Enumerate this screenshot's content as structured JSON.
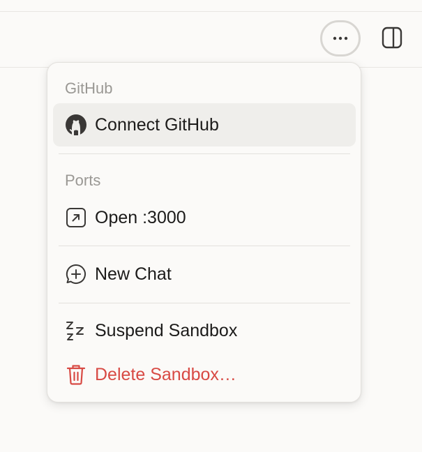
{
  "toolbar": {
    "more_icon": "ellipsis-icon",
    "panel_icon": "sidebar-toggle-icon"
  },
  "menu": {
    "github_section_label": "GitHub",
    "connect_github_label": "Connect GitHub",
    "ports_section_label": "Ports",
    "open_port_label": "Open :3000",
    "new_chat_label": "New Chat",
    "suspend_label": "Suspend Sandbox",
    "delete_label": "Delete Sandbox…"
  },
  "colors": {
    "danger": "#d84a44",
    "highlight_bg": "#efeeeb",
    "muted_text": "#9a9894"
  }
}
